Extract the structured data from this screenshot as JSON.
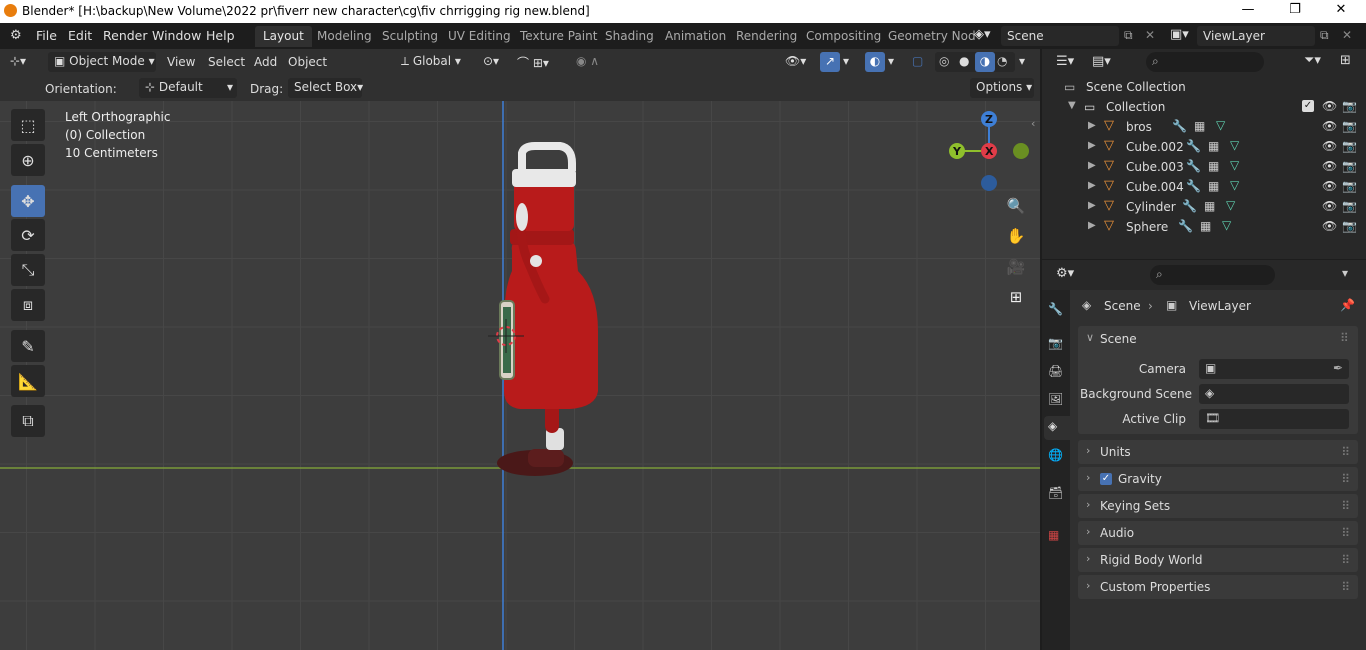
{
  "window": {
    "title": "Blender* [H:\\backup\\New Volume\\2022 pr\\fiverr new character\\cg\\fiv chrrigging rig new.blend]",
    "minimize": "—",
    "maximize": "❐",
    "close": "✕"
  },
  "menu": [
    "File",
    "Edit",
    "Render",
    "Window",
    "Help"
  ],
  "workspaces": [
    "Layout",
    "Modeling",
    "Sculpting",
    "UV Editing",
    "Texture Paint",
    "Shading",
    "Animation",
    "Rendering",
    "Compositing",
    "Geometry Nod"
  ],
  "scene_field": "Scene",
  "viewlayer_field": "ViewLayer",
  "viewport_header": {
    "mode": "Object Mode",
    "menus": [
      "View",
      "Select",
      "Add",
      "Object"
    ],
    "orientation": "Global"
  },
  "tool_settings": {
    "orientation_label": "Orientation:",
    "orientation_value": "Default",
    "drag_label": "Drag:",
    "drag_value": "Select Box",
    "options": "Options"
  },
  "viewport_info": {
    "view": "Left Orthographic",
    "collection": "(0) Collection",
    "scale": "10 Centimeters"
  },
  "gizmo": {
    "z": "Z",
    "y": "Y",
    "x": "X"
  },
  "outliner": {
    "root": "Scene Collection",
    "collection": "Collection",
    "objects": [
      "bros",
      "Cube.002",
      "Cube.003",
      "Cube.004",
      "Cylinder",
      "Sphere"
    ]
  },
  "properties": {
    "breadcrumb_scene": "Scene",
    "breadcrumb_layer": "ViewLayer",
    "panel_scene": "Scene",
    "camera_label": "Camera",
    "bg_scene_label": "Background Scene",
    "active_clip_label": "Active Clip",
    "panels": [
      "Units",
      "Gravity",
      "Keying Sets",
      "Audio",
      "Rigid Body World",
      "Custom Properties"
    ],
    "gravity_checked": true
  },
  "colors": {
    "accent": "#4772b3",
    "bottle": "#b81b1b",
    "axis_x": "#e03c48",
    "axis_y": "#8fbf2c",
    "axis_z": "#3e7fd6",
    "horizon": "#7a9a3a"
  }
}
